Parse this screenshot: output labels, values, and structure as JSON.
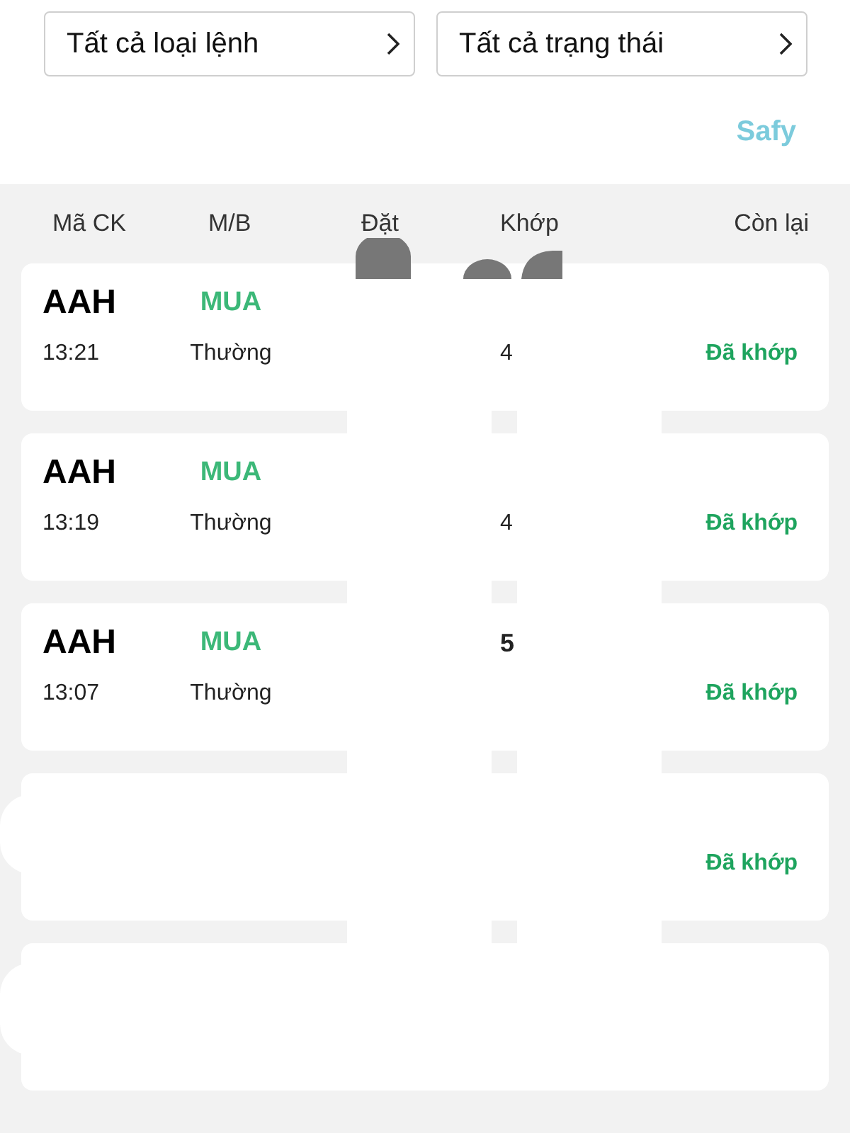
{
  "filters": [
    {
      "label": "Tất cả loại lệnh"
    },
    {
      "label": "Tất cả trạng thái"
    }
  ],
  "brand_label": "Safy",
  "table": {
    "columns": [
      "Mã CK",
      "M/B",
      "Đặt",
      "Khớp",
      "Còn lại"
    ],
    "rows": [
      {
        "symbol": "AAH",
        "side": "MUA",
        "time": "13:21",
        "order_type": "Thường",
        "matched_line_2": "4",
        "status": "Đã khớp"
      },
      {
        "symbol": "AAH",
        "side": "MUA",
        "time": "13:19",
        "order_type": "Thường",
        "matched_line_2": "4",
        "status": "Đã khớp"
      },
      {
        "symbol": "AAH",
        "side": "MUA",
        "time": "13:07",
        "order_type": "Thường",
        "matched_line_1": "5",
        "status": "Đã khớp"
      },
      {
        "status": "Đã khớp"
      },
      {}
    ]
  }
}
